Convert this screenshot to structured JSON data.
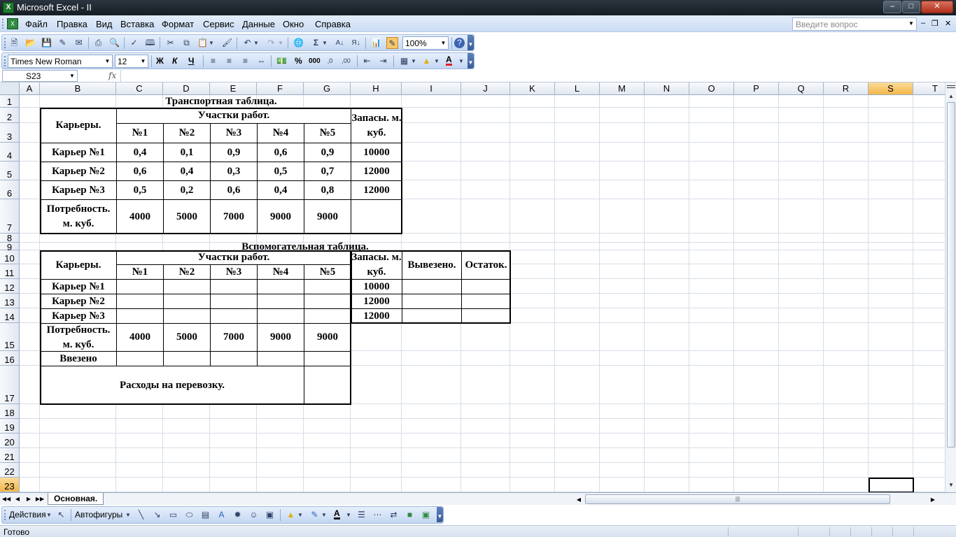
{
  "window": {
    "title": "Microsoft Excel - II",
    "app_icon": "X"
  },
  "menu": [
    "Файл",
    "Правка",
    "Вид",
    "Вставка",
    "Формат",
    "Сервис",
    "Данные",
    "Окно",
    "Справка"
  ],
  "help_placeholder": "Введите вопрос",
  "toolbar": {
    "zoom": "100%",
    "font_name": "Times New Roman",
    "font_size": "12",
    "bold": "Ж",
    "italic": "К",
    "underline": "Ч",
    "percent": "%",
    "thousands": "000"
  },
  "formula_bar": {
    "name_box": "S23",
    "fx": "fx",
    "content": ""
  },
  "columns": [
    "A",
    "B",
    "C",
    "D",
    "E",
    "F",
    "G",
    "H",
    "I",
    "J",
    "K",
    "L",
    "M",
    "N",
    "O",
    "P",
    "Q",
    "R",
    "S",
    "T"
  ],
  "rows": [
    "1",
    "2",
    "3",
    "4",
    "5",
    "6",
    "7",
    "8",
    "9",
    "10",
    "11",
    "12",
    "13",
    "14",
    "15",
    "16",
    "17",
    "18",
    "19",
    "20",
    "21",
    "22",
    "23"
  ],
  "active_cell": {
    "column": "S",
    "row": "23"
  },
  "transport_table": {
    "title": "Транспортная таблица.",
    "quarries_header": "Карьеры.",
    "sites_header": "Участки работ.",
    "stock_header": "Запасы. м. куб.",
    "site_labels": [
      "№1",
      "№2",
      "№3",
      "№4",
      "№5"
    ],
    "rows": [
      {
        "label": "Карьер №1",
        "values": [
          "0,4",
          "0,1",
          "0,9",
          "0,6",
          "0,9"
        ],
        "stock": "10000"
      },
      {
        "label": "Карьер №2",
        "values": [
          "0,6",
          "0,4",
          "0,3",
          "0,5",
          "0,7"
        ],
        "stock": "12000"
      },
      {
        "label": "Карьер №3",
        "values": [
          "0,5",
          "0,2",
          "0,6",
          "0,4",
          "0,8"
        ],
        "stock": "12000"
      }
    ],
    "demand_label": "Потребность. м. куб.",
    "demand": [
      "4000",
      "5000",
      "7000",
      "9000",
      "9000"
    ]
  },
  "aux_table": {
    "title": "Вспомогательная таблица.",
    "quarries_header": "Карьеры.",
    "sites_header": "Участки работ.",
    "stock_header": "Запасы. м. куб.",
    "exported_header": "Вывезено.",
    "remainder_header": "Остаток.",
    "site_labels": [
      "№1",
      "№2",
      "№3",
      "№4",
      "№5"
    ],
    "rows": [
      {
        "label": "Карьер №1",
        "stock": "10000"
      },
      {
        "label": "Карьер №2",
        "stock": "12000"
      },
      {
        "label": "Карьер №3",
        "stock": "12000"
      }
    ],
    "demand_label": "Потребность. м. куб.",
    "demand": [
      "4000",
      "5000",
      "7000",
      "9000",
      "9000"
    ],
    "imported_label": "Ввезено",
    "cost_label": "Расходы на перевозку."
  },
  "sheet_tab": "Основная.",
  "draw_toolbar": {
    "actions": "Действия",
    "autoshapes": "Автофигуры"
  },
  "status": "Готово"
}
